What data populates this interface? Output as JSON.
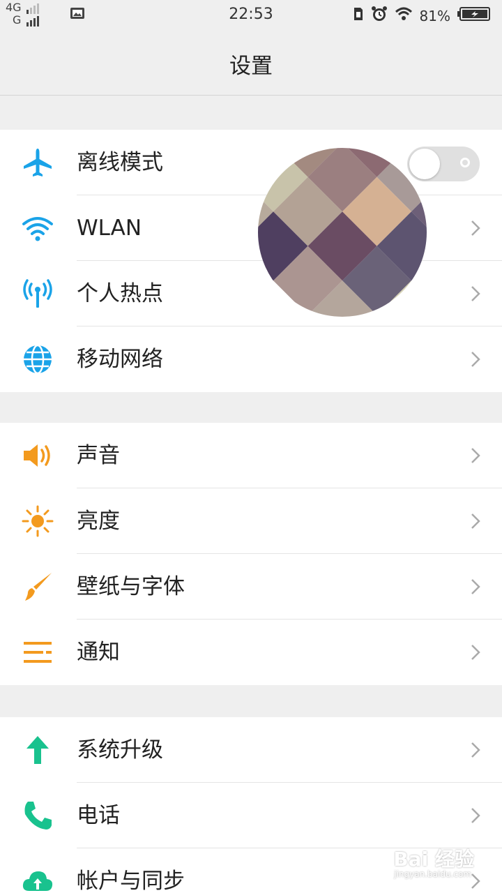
{
  "status_bar": {
    "net_top": "4G",
    "net_bottom": "G",
    "time": "22:53",
    "battery_percent": "81%",
    "icons": [
      "picture-icon",
      "sim-icon",
      "alarm-icon",
      "wifi-icon",
      "battery-icon"
    ]
  },
  "header": {
    "title": "设置"
  },
  "groups": [
    {
      "items": [
        {
          "label": "离线模式",
          "icon": "airplane-icon",
          "color": "#1aa3e8",
          "control": "toggle",
          "toggle_on": false
        },
        {
          "label": "WLAN",
          "icon": "wifi-icon",
          "color": "#1aa3e8",
          "value": ""
        },
        {
          "label": "个人热点",
          "icon": "hotspot-icon",
          "color": "#1aa3e8"
        },
        {
          "label": "移动网络",
          "icon": "globe-icon",
          "color": "#1aa3e8"
        }
      ]
    },
    {
      "items": [
        {
          "label": "声音",
          "icon": "speaker-icon",
          "color": "#f39a1e"
        },
        {
          "label": "亮度",
          "icon": "sun-icon",
          "color": "#f39a1e"
        },
        {
          "label": "壁纸与字体",
          "icon": "brush-icon",
          "color": "#f39a1e"
        },
        {
          "label": "通知",
          "icon": "notification-list-icon",
          "color": "#f39a1e"
        }
      ]
    },
    {
      "items": [
        {
          "label": "系统升级",
          "icon": "upgrade-arrow-icon",
          "color": "#19c28e"
        },
        {
          "label": "电话",
          "icon": "phone-icon",
          "color": "#19c28e"
        },
        {
          "label": "帐户与同步",
          "icon": "cloud-sync-icon",
          "color": "#19c28e"
        }
      ]
    }
  ],
  "watermark": {
    "text": "Bai 经验",
    "sub": "jingyan.baidu.com"
  }
}
